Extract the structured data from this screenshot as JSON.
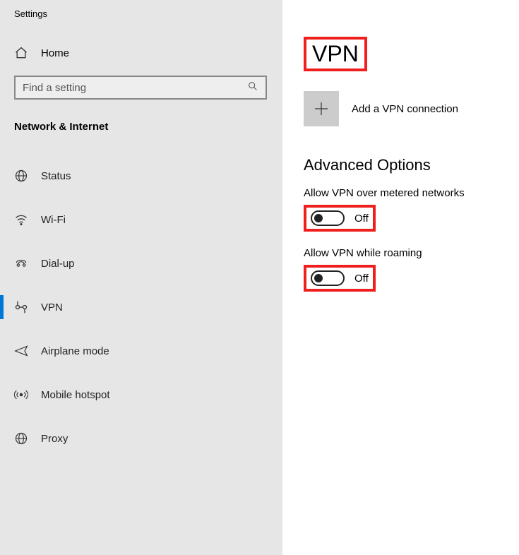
{
  "window": {
    "title": "Settings"
  },
  "sidebar": {
    "home_label": "Home",
    "search_placeholder": "Find a setting",
    "section_title": "Network & Internet",
    "items": [
      {
        "label": "Status",
        "icon": "globe"
      },
      {
        "label": "Wi-Fi",
        "icon": "wifi"
      },
      {
        "label": "Dial-up",
        "icon": "dialup"
      },
      {
        "label": "VPN",
        "icon": "vpn",
        "active": true
      },
      {
        "label": "Airplane mode",
        "icon": "airplane"
      },
      {
        "label": "Mobile hotspot",
        "icon": "hotspot"
      },
      {
        "label": "Proxy",
        "icon": "globe"
      }
    ]
  },
  "main": {
    "title": "VPN",
    "add_label": "Add a VPN connection",
    "advanced_title": "Advanced Options",
    "options": [
      {
        "label": "Allow VPN over metered networks",
        "status": "Off"
      },
      {
        "label": "Allow VPN while roaming",
        "status": "Off"
      }
    ]
  },
  "highlight_color": "#ef1f1d"
}
